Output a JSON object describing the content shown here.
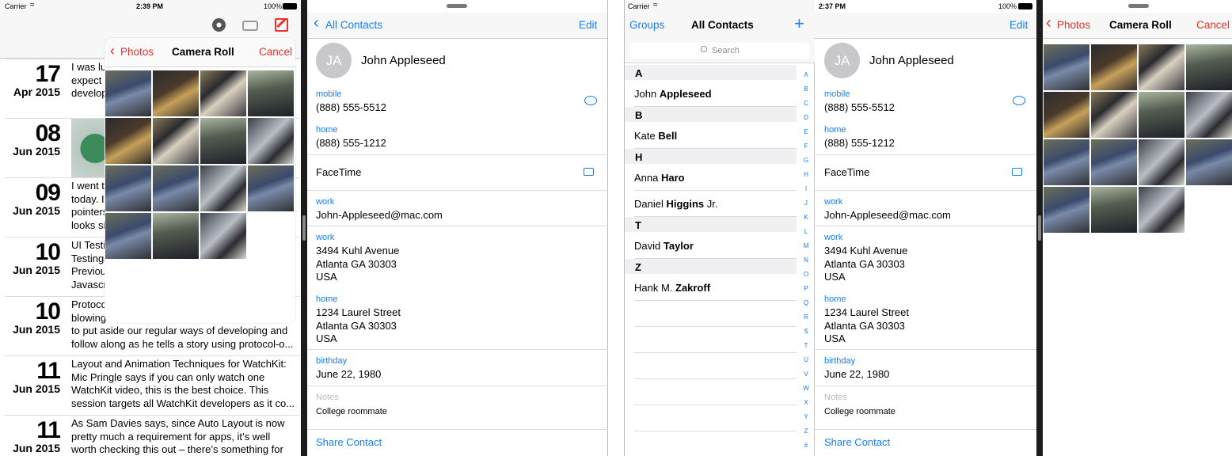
{
  "left": {
    "status": {
      "carrier": "Carrier",
      "time": "2:39 PM",
      "battery": "100%"
    },
    "journal": [
      {
        "day": "17",
        "month": "Apr 2015",
        "text": [
          "I was lu",
          "expect",
          "develop"
        ]
      },
      {
        "day": "08",
        "month": "Jun 2015",
        "text": []
      },
      {
        "day": "09",
        "month": "Jun 2015",
        "text": [
          "I went t",
          "today. I",
          "pointers",
          "looks si"
        ]
      },
      {
        "day": "10",
        "month": "Jun 2015",
        "text": [
          "UI Testi",
          "Testing",
          "Previou",
          "Javascr"
        ]
      },
      {
        "day": "10",
        "month": "Jun 2015",
        "text": [
          "Protoco",
          "blowing",
          "to put aside our regular ways of developing and",
          "follow along as he tells a story using protocol-o..."
        ]
      },
      {
        "day": "11",
        "month": "Jun 2015",
        "text": [
          "Layout and Animation Techniques for WatchKit:",
          "Mic Pringle says if you can only watch one",
          "WatchKit video, this is the best choice. This",
          "session targets all WatchKit developers as it co..."
        ]
      },
      {
        "day": "11",
        "month": "Jun 2015",
        "text": [
          "As Sam Davies says, since Auto Layout is now",
          "pretty much a requirement for apps, it’s well",
          "worth checking this out – there’s something for"
        ]
      }
    ],
    "popover": {
      "back": "Photos",
      "title": "Camera Roll",
      "cancel": "Cancel",
      "photo_count": 15
    }
  },
  "contact": {
    "nav_back": "All Contacts",
    "edit": "Edit",
    "initials": "JA",
    "name": "John Appleseed",
    "mobile_label": "mobile",
    "mobile": "(888) 555-5512",
    "home_label": "home",
    "home": "(888) 555-1212",
    "facetime": "FaceTime",
    "work_email_label": "work",
    "work_email": "John-Appleseed@mac.com",
    "work_addr_label": "work",
    "work_addr": [
      "3494 Kuhl Avenue",
      "Atlanta GA 30303",
      "USA"
    ],
    "home_addr_label": "home",
    "home_addr": [
      "1234 Laurel Street",
      "Atlanta GA 30303",
      "USA"
    ],
    "birthday_label": "birthday",
    "birthday": "June 22, 1980",
    "notes_label": "Notes",
    "notes": "College roommate",
    "share": "Share Contact"
  },
  "right": {
    "status": {
      "carrier": "Carrier",
      "time": "2:37 PM",
      "battery": "100%"
    },
    "groups": "Groups",
    "title": "All Contacts",
    "add": "+",
    "search_placeholder": "Search",
    "sections": [
      {
        "letter": "A",
        "rows": [
          {
            "first": "John ",
            "last": "Appleseed",
            "suffix": ""
          }
        ]
      },
      {
        "letter": "B",
        "rows": [
          {
            "first": "Kate ",
            "last": "Bell",
            "suffix": ""
          }
        ]
      },
      {
        "letter": "H",
        "rows": [
          {
            "first": "Anna ",
            "last": "Haro",
            "suffix": ""
          },
          {
            "first": "Daniel ",
            "last": "Higgins",
            "suffix": " Jr."
          }
        ]
      },
      {
        "letter": "T",
        "rows": [
          {
            "first": "David ",
            "last": "Taylor",
            "suffix": ""
          }
        ]
      },
      {
        "letter": "Z",
        "rows": [
          {
            "first": "Hank M. ",
            "last": "Zakroff",
            "suffix": ""
          }
        ]
      }
    ],
    "index": [
      "A",
      "B",
      "C",
      "D",
      "E",
      "F",
      "G",
      "H",
      "I",
      "J",
      "K",
      "L",
      "M",
      "N",
      "O",
      "P",
      "Q",
      "R",
      "S",
      "T",
      "U",
      "V",
      "W",
      "X",
      "Y",
      "Z",
      "#"
    ],
    "camera": {
      "back": "Photos",
      "title": "Camera Roll",
      "cancel": "Cancel",
      "photo_count": 15
    }
  }
}
